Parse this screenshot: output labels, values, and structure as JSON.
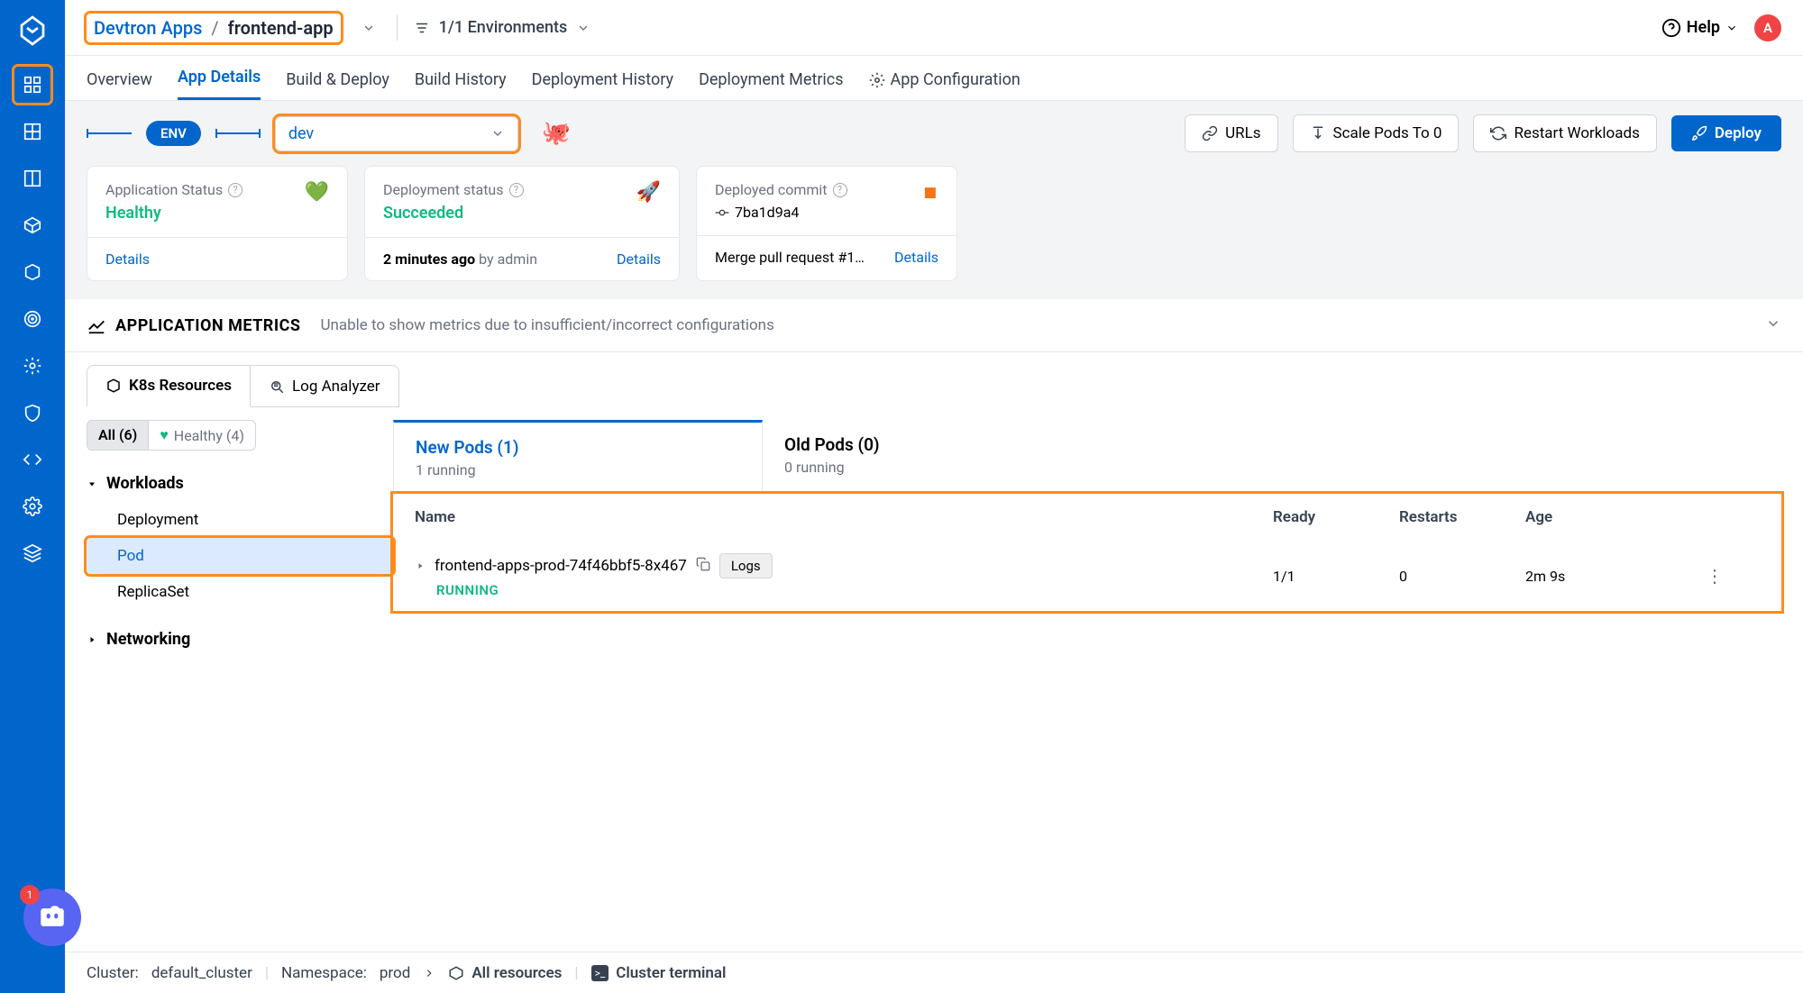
{
  "breadcrumb": {
    "group": "Devtron Apps",
    "sep": "/",
    "current": "frontend-app"
  },
  "header": {
    "env_filter": "1/1 Environments",
    "help": "Help",
    "avatar": "A"
  },
  "tabs": {
    "overview": "Overview",
    "app_details": "App Details",
    "build_deploy": "Build & Deploy",
    "build_history": "Build History",
    "deployment_history": "Deployment History",
    "deployment_metrics": "Deployment Metrics",
    "app_config": "App Configuration"
  },
  "envbar": {
    "label": "ENV",
    "selected": "dev",
    "urls": "URLs",
    "scale": "Scale Pods To 0",
    "restart": "Restart Workloads",
    "deploy": "Deploy"
  },
  "cards": {
    "status": {
      "label": "Application Status",
      "value": "Healthy",
      "details": "Details"
    },
    "deploy": {
      "label": "Deployment status",
      "value": "Succeeded",
      "time": "2 minutes ago",
      "by": "by admin",
      "details": "Details"
    },
    "commit": {
      "label": "Deployed commit",
      "hash": "7ba1d9a4",
      "msg": "Merge pull request #1…",
      "details": "Details"
    }
  },
  "metrics": {
    "title": "APPLICATION METRICS",
    "msg": "Unable to show metrics due to insufficient/incorrect configurations"
  },
  "subtabs": {
    "k8s": "K8s Resources",
    "log": "Log Analyzer"
  },
  "filters": {
    "all": "All (6)",
    "healthy": "Healthy (4)"
  },
  "tree": {
    "workloads": "Workloads",
    "deployment": "Deployment",
    "pod": "Pod",
    "replicaset": "ReplicaSet",
    "networking": "Networking"
  },
  "pod_tabs": {
    "new": {
      "title": "New Pods (1)",
      "sub": "1 running"
    },
    "old": {
      "title": "Old Pods (0)",
      "sub": "0 running"
    }
  },
  "pod_table": {
    "headers": {
      "name": "Name",
      "ready": "Ready",
      "restarts": "Restarts",
      "age": "Age"
    },
    "row": {
      "name": "frontend-apps-prod-74f46bbf5-8x467",
      "logs": "Logs",
      "status": "RUNNING",
      "ready": "1/1",
      "restarts": "0",
      "age": "2m 9s"
    }
  },
  "bottombar": {
    "cluster_label": "Cluster:",
    "cluster": "default_cluster",
    "ns_label": "Namespace:",
    "ns": "prod",
    "all_resources": "All resources",
    "terminal": "Cluster terminal"
  },
  "discord_count": "1"
}
